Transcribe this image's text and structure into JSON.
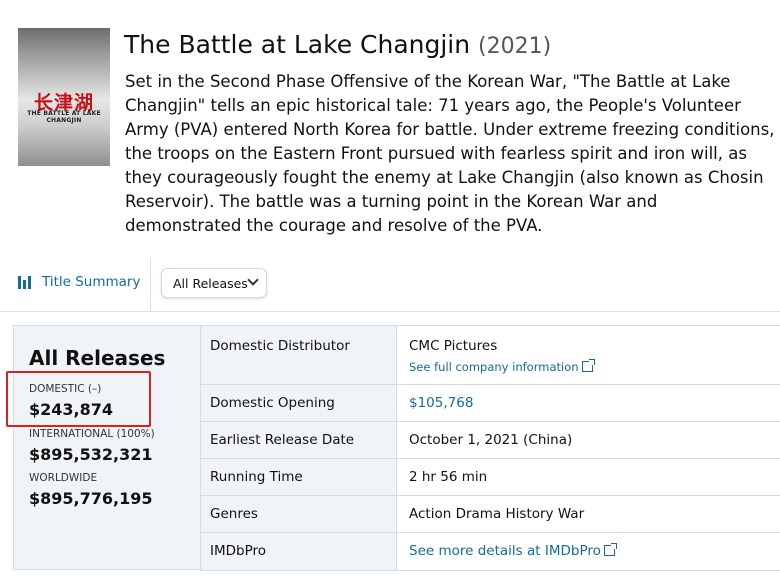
{
  "movie": {
    "title": "The Battle at Lake Changjin",
    "year": "(2021)",
    "synopsis": "Set in the Second Phase Offensive of the Korean War, \"The Battle at Lake Changjin\" tells an epic historical tale: 71 years ago, the People's Volunteer Army (PVA) entered North Korea for battle. Under extreme freezing conditions, the troops on the Eastern Front pursued with fearless spirit and iron will, as they courageously fought the enemy at Lake Changjin (also known as Chosin Reservoir). The battle was a turning point in the Korean War and demonstrated the courage and resolve of the PVA."
  },
  "poster": {
    "title_zh": "长津湖",
    "title_en": "THE BATTLE AT LAKE CHANGJIN"
  },
  "tabs": {
    "title_summary": "Title Summary",
    "release_select": "All Releases"
  },
  "summary": {
    "heading": "All Releases",
    "domestic_label": "DOMESTIC (–)",
    "domestic_value": "$243,874",
    "international_label": "INTERNATIONAL (100%)",
    "international_value": "$895,532,321",
    "worldwide_label": "WORLDWIDE",
    "worldwide_value": "$895,776,195"
  },
  "details": [
    {
      "label": "Domestic Distributor",
      "value": "CMC Pictures",
      "sublink": "See full company information"
    },
    {
      "label": "Domestic Opening",
      "value": "$105,768"
    },
    {
      "label": "Earliest Release Date",
      "value": "October 1, 2021 (China)"
    },
    {
      "label": "Running Time",
      "value": "2 hr 56 min"
    },
    {
      "label": "Genres",
      "value": "Action Drama History War"
    },
    {
      "label": "IMDbPro",
      "value": "See more details at IMDbPro"
    }
  ],
  "colors": {
    "link": "#136c9e",
    "highlight": "#e0201e",
    "panel_bg": "#f0f4f7"
  }
}
